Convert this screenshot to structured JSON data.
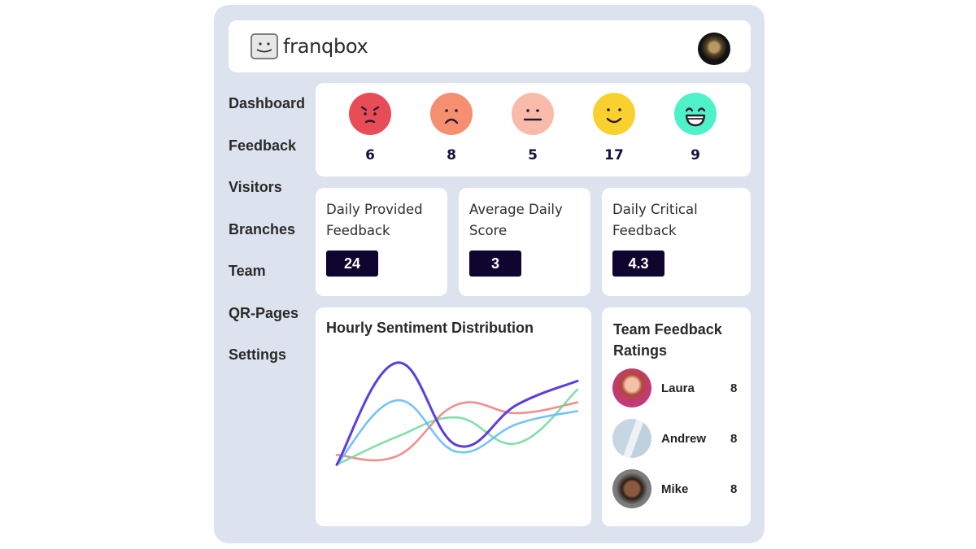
{
  "app": {
    "name": "franqbox"
  },
  "header": {
    "logo_icon": "smiley-box-icon",
    "user_avatar": "user-avatar"
  },
  "sidebar": {
    "items": [
      {
        "label": "Dashboard"
      },
      {
        "label": "Feedback"
      },
      {
        "label": "Visitors"
      },
      {
        "label": "Branches"
      },
      {
        "label": "Team"
      },
      {
        "label": "QR-Pages"
      },
      {
        "label": "Settings"
      }
    ]
  },
  "sentiment_counts": [
    {
      "icon": "angry-face-icon",
      "color": "#e84c56",
      "count": "6"
    },
    {
      "icon": "sad-face-icon",
      "color": "#f68f70",
      "count": "8"
    },
    {
      "icon": "neutral-face-icon",
      "color": "#f9bba9",
      "count": "5"
    },
    {
      "icon": "happy-face-icon",
      "color": "#f9d12f",
      "count": "17"
    },
    {
      "icon": "very-happy-face-icon",
      "color": "#4ff2c8",
      "count": "9"
    }
  ],
  "stats": [
    {
      "label_line1": "Daily Provided",
      "label_line2": "Feedback",
      "value": "24"
    },
    {
      "label_line1": "Average Daily",
      "label_line2": "Score",
      "value": "3"
    },
    {
      "label_line1": "Daily Critical",
      "label_line2": "Feedback",
      "value": "4.3"
    }
  ],
  "chart_data": {
    "type": "line",
    "title": "Hourly Sentiment Distribution",
    "xlabel": "",
    "ylabel": "",
    "grid": false,
    "legend": "none",
    "x": [
      0,
      1,
      2,
      3,
      4
    ],
    "ylim": [
      0,
      100
    ],
    "series": [
      {
        "name": "purple",
        "color": "#5b3de0",
        "values": [
          2,
          97,
          20,
          58,
          80
        ]
      },
      {
        "name": "blue",
        "color": "#5db8f7",
        "values": [
          2,
          62,
          14,
          40,
          52
        ]
      },
      {
        "name": "green",
        "color": "#6fd89a",
        "values": [
          2,
          28,
          46,
          22,
          72
        ]
      },
      {
        "name": "red",
        "color": "#f07a7a",
        "values": [
          11,
          10,
          58,
          50,
          60
        ]
      }
    ]
  },
  "team": {
    "title_line1": "Team Feedback",
    "title_line2": "Ratings",
    "members": [
      {
        "name": "Laura",
        "score": "8"
      },
      {
        "name": "Andrew",
        "score": "8"
      },
      {
        "name": "Mike",
        "score": "8"
      }
    ]
  }
}
